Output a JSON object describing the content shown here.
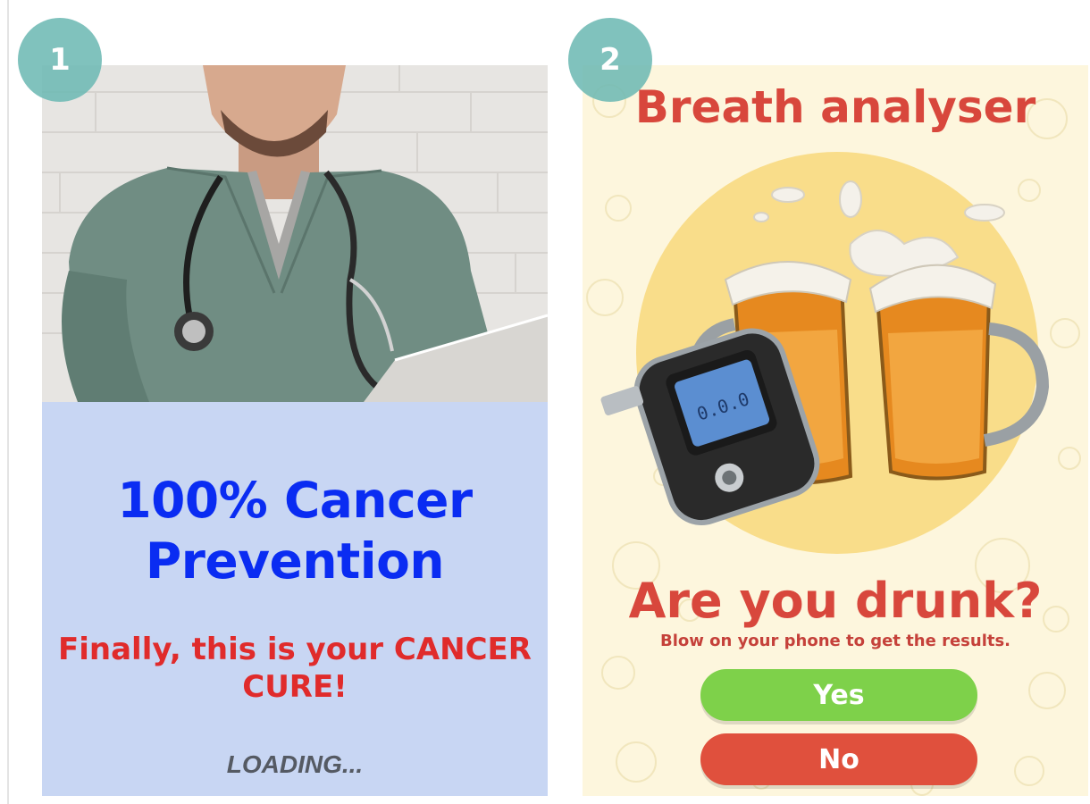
{
  "badges": {
    "first": "1",
    "second": "2"
  },
  "panel1": {
    "headline": "100% Cancer Prevention",
    "subheadline": "Finally, this is your CANCER CURE!",
    "loading": "LOADING..."
  },
  "panel2": {
    "title": "Breath analyser",
    "device_reading": "0.0.0",
    "question": "Are you drunk?",
    "instruction": "Blow on your phone to get the results.",
    "yes_label": "Yes",
    "no_label": "No"
  },
  "colors": {
    "headline_blue": "#0a2cf2",
    "alert_red": "#e02b2b",
    "info_bg": "#c8d6f3",
    "badge_teal": "#6ebab4",
    "yes_green": "#7ed14a",
    "no_red": "#e0503d",
    "title_red": "#d8473c",
    "cream_bg": "#fdf6dd"
  }
}
